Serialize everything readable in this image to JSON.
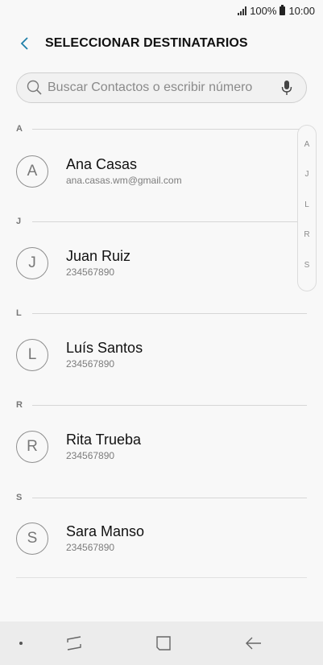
{
  "status_bar": {
    "battery_text": "100%",
    "time": "10:00"
  },
  "header": {
    "title": "SELECCIONAR DESTINATARIOS",
    "back_icon": "chevron-left-icon"
  },
  "search": {
    "placeholder": "Buscar Contactos o escribir número",
    "search_icon": "search-icon",
    "mic_icon": "microphone-icon"
  },
  "sections": [
    {
      "letter": "A",
      "contacts": [
        {
          "initial": "A",
          "name": "Ana Casas",
          "detail": "ana.casas.wm@gmail.com"
        }
      ]
    },
    {
      "letter": "J",
      "contacts": [
        {
          "initial": "J",
          "name": "Juan Ruiz",
          "detail": "234567890"
        }
      ]
    },
    {
      "letter": "L",
      "contacts": [
        {
          "initial": "L",
          "name": "Luís Santos",
          "detail": "234567890"
        }
      ]
    },
    {
      "letter": "R",
      "contacts": [
        {
          "initial": "R",
          "name": "Rita Trueba",
          "detail": "234567890"
        }
      ]
    },
    {
      "letter": "S",
      "contacts": [
        {
          "initial": "S",
          "name": "Sara Manso",
          "detail": "234567890"
        }
      ]
    }
  ],
  "index_bar": [
    "A",
    "J",
    "L",
    "R",
    "S"
  ],
  "nav_bar": {
    "icons": [
      "recent-apps-icon",
      "home-icon",
      "back-arrow-icon"
    ]
  },
  "colors": {
    "accent": "#1f7fa8",
    "background": "#f8f8f8",
    "nav_bar": "#ececec"
  }
}
